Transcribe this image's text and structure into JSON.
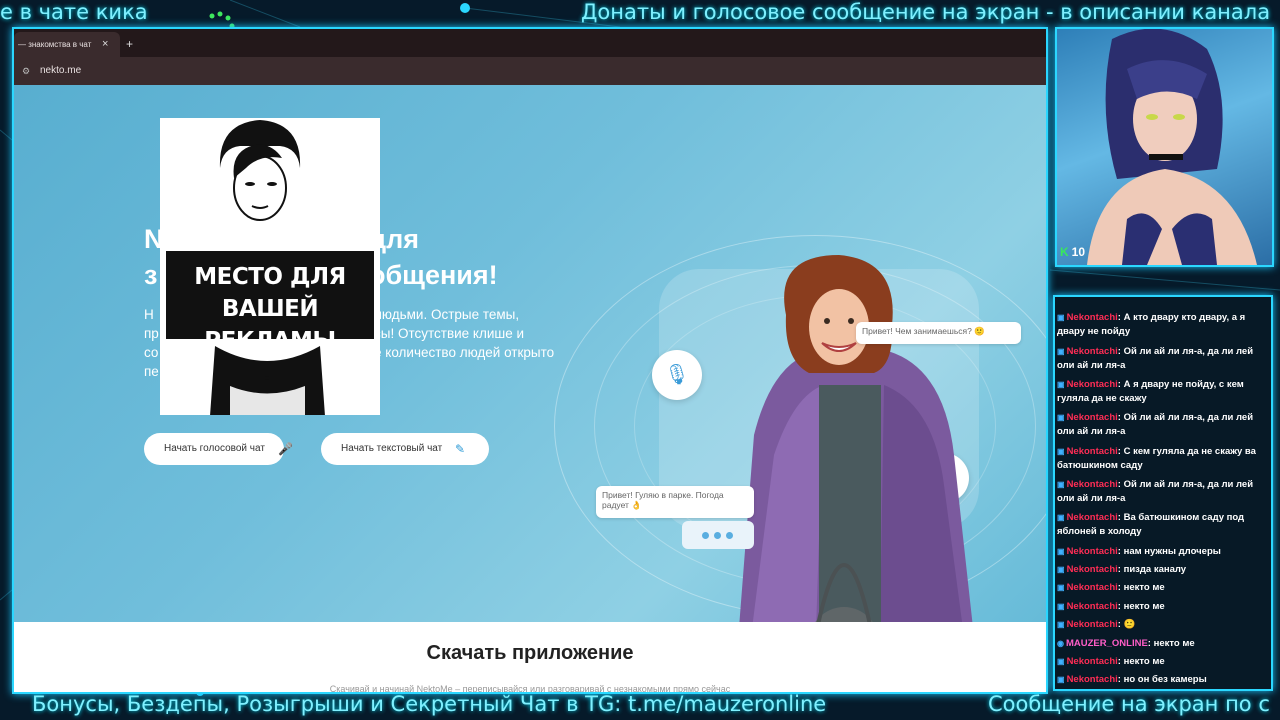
{
  "overlay": {
    "ticker_top_left": "е в чате кика",
    "ticker_top_right": "Донаты и голосовое сообщение на экран - в описании канала",
    "ticker_bottom_left": "Бонусы, Бездепы, Розыгрыши и Секретный Чат в TG: t.me/mauzeronline",
    "ticker_bottom_right": "Сообщение на экран по с",
    "accent": "#2bd7ff"
  },
  "browser": {
    "tab_title": "— знакомства в чат",
    "tab_close": "×",
    "new_tab": "+",
    "url": "nekto.me"
  },
  "page": {
    "headline_l1a": "N",
    "headline_l1b": "для",
    "headline_l2a": "з",
    "headline_l2b": "общения!",
    "desc_rows": [
      {
        "a": "Н",
        "b": "людьми. Острые темы,"
      },
      {
        "a": "пр",
        "b": "сы! Отсутствие клише и"
      },
      {
        "a": "со",
        "b": "е количество людей открыто"
      },
      {
        "a": "пе",
        "b": ""
      }
    ],
    "btn_voice": "Начать голосовой чат",
    "btn_text": "Начать текстовый чат",
    "bubble_1": "Привет! Чем занимаешься? 🙂",
    "bubble_2": "Привет! Гуляю в парке. Погода радует 👌",
    "download_title": "Скачать приложение",
    "download_sub": "Скачивай и начинай NektoMe – переписывайся или разговаривай с незнакомыми прямо сейчас"
  },
  "ad": {
    "line1": "МЕСТО ДЛЯ",
    "line2": "ВАШЕЙ РЕКЛАМЫ"
  },
  "cam": {
    "badge_icon": "K",
    "viewers": "10"
  },
  "chat": {
    "messages": [
      {
        "user": "Nekontachi",
        "text": ": А кто двару кто двару, а я двару не пойду"
      },
      {
        "user": "Nekontachi",
        "text": ": Ой ли ай ли ля-а, да ли лей оли ай ли ля-а"
      },
      {
        "user": "Nekontachi",
        "text": ": А я двару не пойду, с кем гуляла да не скажу"
      },
      {
        "user": "Nekontachi",
        "text": ": Ой ли ай ли ля-а, да ли лей оли ай ли ля-а"
      },
      {
        "user": "Nekontachi",
        "text": ": С кем гуляла да не скажу ва батюшкином саду"
      },
      {
        "user": "Nekontachi",
        "text": ": Ой ли ай ли ля-а, да ли лей оли ай ли ля-а"
      },
      {
        "user": "Nekontachi",
        "text": ": Ва батюшкином саду под яблоней в холоду"
      },
      {
        "user": "Nekontachi",
        "text": ": нам нужны длочеры"
      },
      {
        "user": "Nekontachi",
        "text": ": пизда каналу"
      },
      {
        "user": "Nekontachi",
        "text": ": некто ме"
      },
      {
        "user": "Nekontachi",
        "text": ": некто ме"
      },
      {
        "user": "Nekontachi",
        "text": ":"
      },
      {
        "user": "MAUZER_ONLINE",
        "text": ": некто ме"
      },
      {
        "user": "Nekontachi",
        "text": ": некто ме"
      },
      {
        "user": "Nekontachi",
        "text": ": но он без камеры"
      }
    ]
  }
}
